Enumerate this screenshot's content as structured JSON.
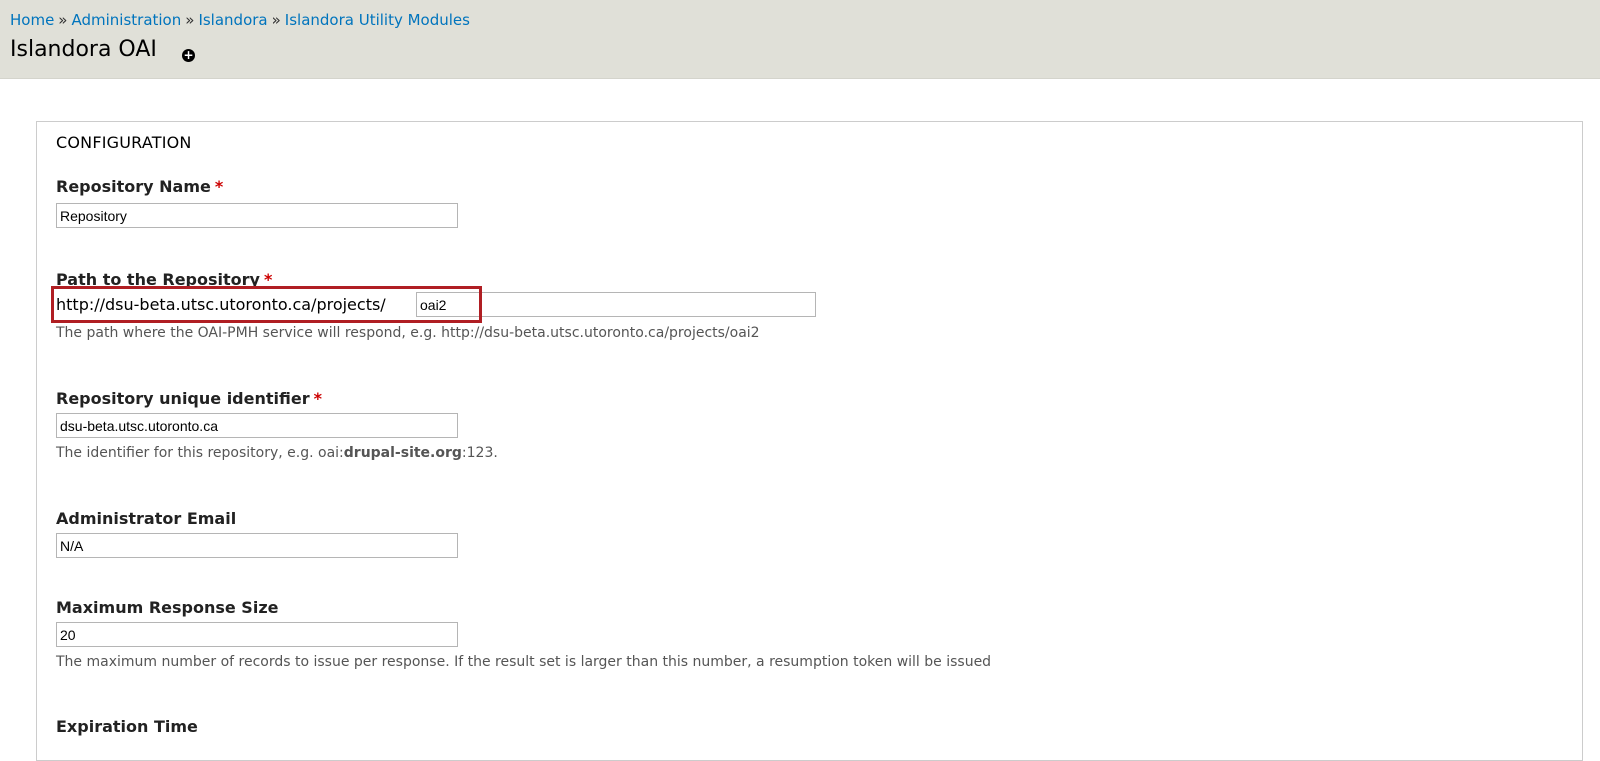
{
  "breadcrumb": {
    "items": [
      "Home",
      "Administration",
      "Islandora",
      "Islandora Utility Modules"
    ],
    "separator": "»"
  },
  "page": {
    "title": "Islandora OAI",
    "shortcut_icon": "add-shortcut-icon"
  },
  "fieldset": {
    "legend": "CONFIGURATION"
  },
  "fields": {
    "repository_name": {
      "label": "Repository Name",
      "required": "*",
      "value": "Repository"
    },
    "path": {
      "label": "Path to the Repository",
      "required": "*",
      "prefix": "http://dsu-beta.utsc.utoronto.ca/projects/",
      "value": "oai2",
      "description": "The path where the OAI-PMH service will respond, e.g. http://dsu-beta.utsc.utoronto.ca/projects/oai2"
    },
    "identifier": {
      "label": "Repository unique identifier",
      "required": "*",
      "value": "dsu-beta.utsc.utoronto.ca",
      "description_pre": "The identifier for this repository, e.g. oai:",
      "description_bold": "drupal-site.org",
      "description_post": ":123."
    },
    "admin_email": {
      "label": "Administrator Email",
      "value": "N/A"
    },
    "max_response": {
      "label": "Maximum Response Size",
      "value": "20",
      "description": "The maximum number of records to issue per response. If the result set is larger than this number, a resumption token will be issued"
    },
    "expiration": {
      "label": "Expiration Time"
    }
  },
  "colors": {
    "header_bg": "#e0e0d8",
    "link": "#0074bd",
    "required": "#cc0000",
    "highlight": "#b01e23"
  }
}
